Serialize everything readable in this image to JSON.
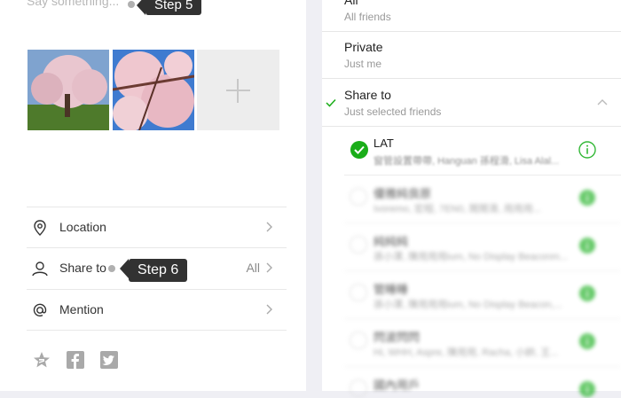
{
  "composer": {
    "placeholder": "Say something...",
    "step5": "Step 5",
    "step6": "Step 6"
  },
  "photos": [
    {
      "icon": "cherry-tree-photo"
    },
    {
      "icon": "cherry-blossom-photo"
    }
  ],
  "rows": {
    "location": "Location",
    "share_to": "Share to",
    "share_value": "All",
    "mention": "Mention"
  },
  "visibility": {
    "all_title": "All",
    "all_sub": "All friends",
    "private_title": "Private",
    "private_sub": "Just me",
    "share_title": "Share to",
    "share_sub": "Just selected friends"
  },
  "friends": [
    {
      "name": "LAT",
      "sub": "窗管設置帶帶, Hanguan 孫程滑, Lisa Alal..."
    },
    {
      "name": "優雅純良原",
      "sub": "Ivoremo, 宏程, 7EN0, 鬧鬧滑, 用用用..."
    },
    {
      "name": "純純純",
      "sub": "孫小澤, 陳用用用ium, No Display Beaconm..."
    },
    {
      "name": "管睡睡",
      "sub": "孫小澤, 陳用用用ium, No Display Beacon,..."
    },
    {
      "name": "閃波閃閃",
      "sub": "Hi, WHH, Aspre, 陳用用, Racha, 小帥, 王..."
    },
    {
      "name": "國內用戶",
      "sub": ""
    }
  ],
  "colors": {
    "green": "#1aad19",
    "info_green": "#33b837"
  }
}
